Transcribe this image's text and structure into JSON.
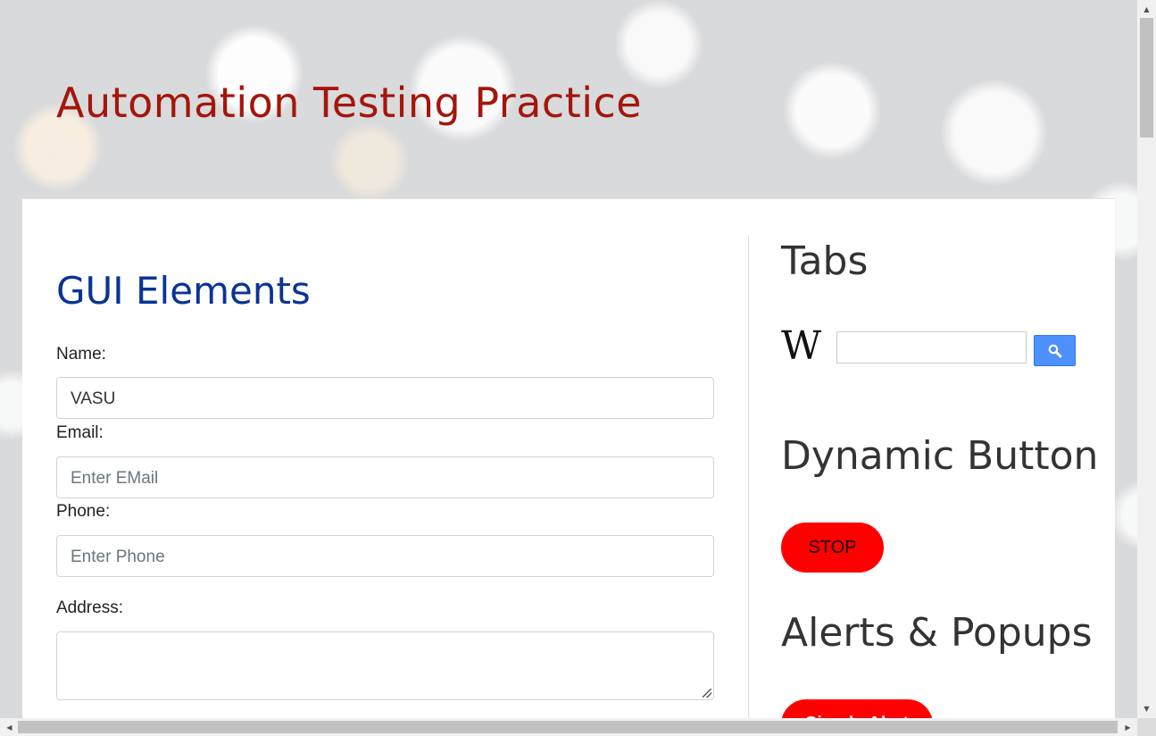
{
  "header": {
    "title": "Automation Testing Practice"
  },
  "gui_elements": {
    "title": "GUI Elements",
    "name_label": "Name:",
    "name_value": "VASU",
    "email_label": "Email:",
    "email_placeholder": "Enter EMail",
    "phone_label": "Phone:",
    "phone_placeholder": "Enter Phone",
    "address_label": "Address:"
  },
  "sidebar": {
    "tabs_title": "Tabs",
    "wiki_logo_text": "W",
    "wiki_search_value": "",
    "dynamic_button_title": "Dynamic Button",
    "stop_button_label": "STOP",
    "alerts_title": "Alerts & Popups",
    "simple_alert_label": "Simple Alert",
    "button_color": "#ff0000"
  },
  "colors": {
    "title_red": "#a4160b",
    "section_blue": "#0a3494",
    "search_button_blue": "#4d90fe"
  },
  "icons": {
    "search": "magnifier-icon"
  }
}
